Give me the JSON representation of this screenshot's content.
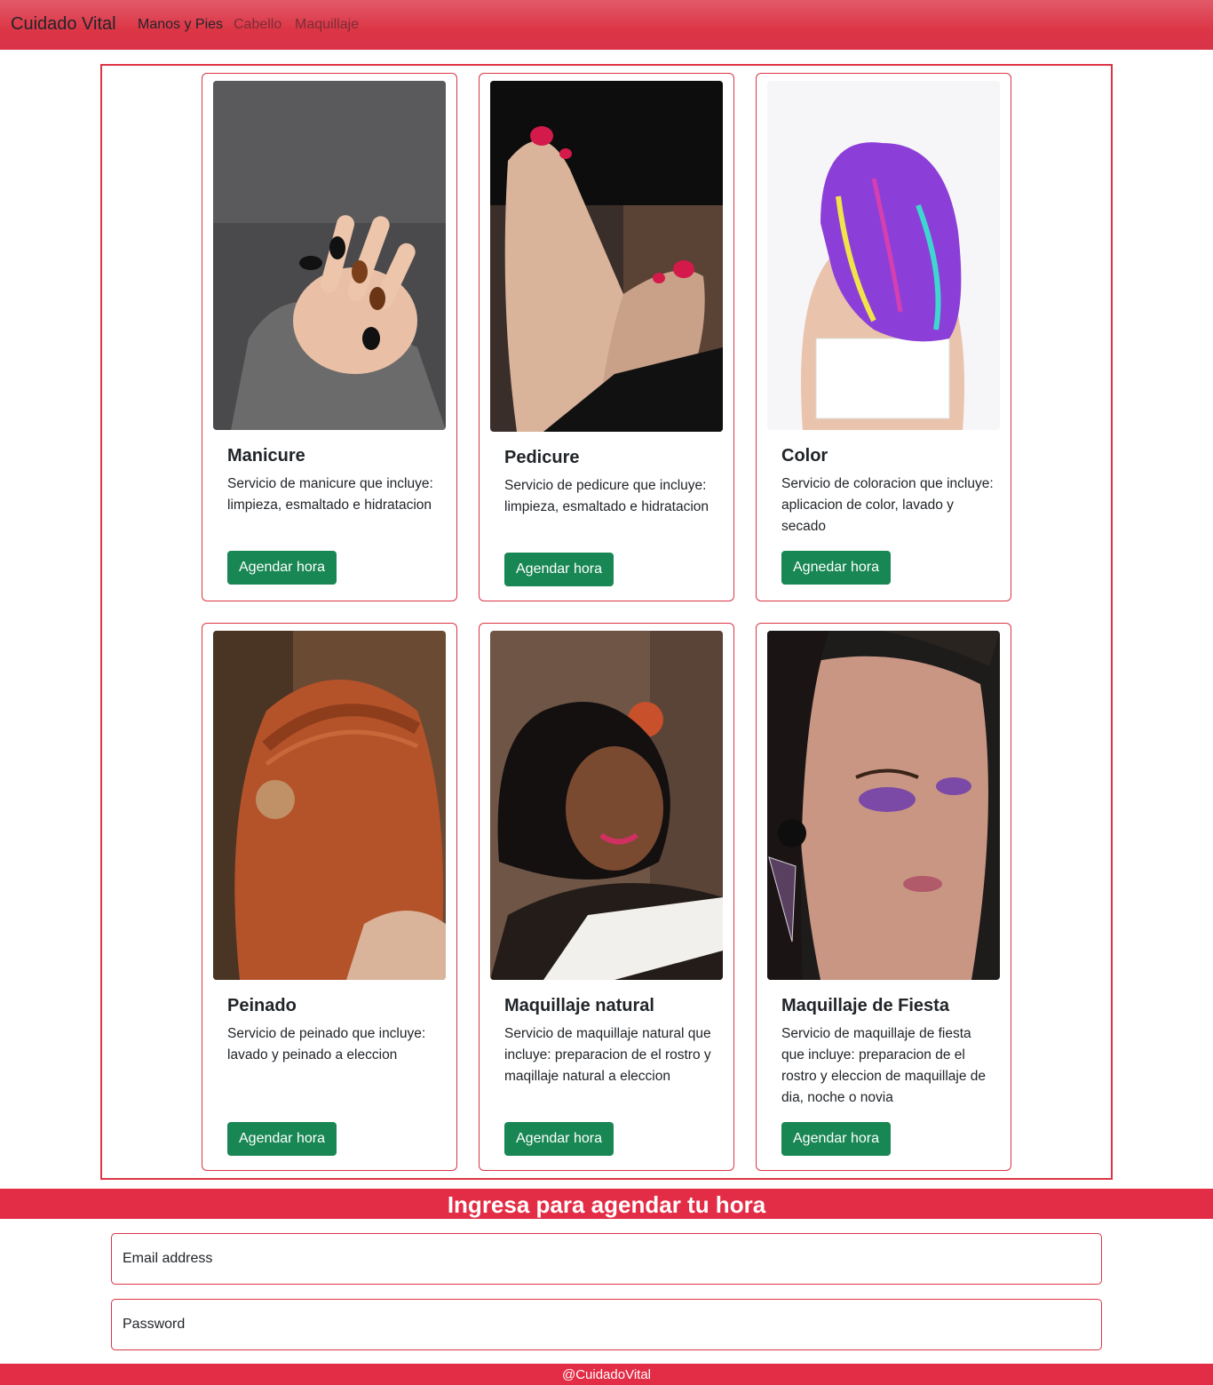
{
  "navbar": {
    "brand": "Cuidado Vital",
    "links": [
      "Manos y Pies",
      "Cabello",
      "Maquillaje"
    ]
  },
  "cards": [
    {
      "title": "Manicure",
      "text": "Servicio de manicure que incluye: limpieza, esmaltado e hidratacion",
      "button": "Agendar hora",
      "image_icon": "manicure-photo"
    },
    {
      "title": "Pedicure",
      "text": "Servicio de pedicure que incluye: limpieza, esmaltado e hidratacion",
      "button": "Agendar hora",
      "image_icon": "pedicure-photo"
    },
    {
      "title": "Color",
      "text": "Servicio de coloracion que incluye: aplicacion de color, lavado y secado",
      "button": "Agnedar hora",
      "image_icon": "hair-color-photo"
    },
    {
      "title": "Peinado",
      "text": "Servicio de peinado que incluye: lavado y peinado a eleccion",
      "button": "Agendar hora",
      "image_icon": "hairstyle-photo"
    },
    {
      "title": "Maquillaje natural",
      "text": "Servicio de maquillaje natural que incluye: preparacion de el rostro y maqillaje natural a eleccion",
      "button": "Agendar hora",
      "image_icon": "natural-makeup-photo"
    },
    {
      "title": "Maquillaje de Fiesta",
      "text": "Servicio de maquillaje de fiesta que incluye: preparacion de el rostro y eleccion de maquillaje de dia, noche o novia",
      "button": "Agendar hora",
      "image_icon": "party-makeup-photo"
    }
  ],
  "login": {
    "heading": "Ingresa para agendar tu hora",
    "email_placeholder": "Email address",
    "password_placeholder": "Password"
  },
  "footer": {
    "text": "@CuidadoVital"
  },
  "colors": {
    "primary": "#dc3545",
    "button": "#198754",
    "banner": "#e32c45"
  }
}
